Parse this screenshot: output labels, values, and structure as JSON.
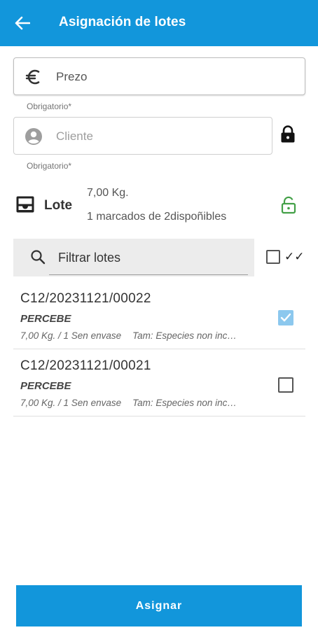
{
  "appbar": {
    "title": "Asignación de lotes",
    "back_icon": "arrow-left-icon",
    "color": "#1296db"
  },
  "price_field": {
    "placeholder": "Prezo",
    "value": "",
    "icon": "euro-icon",
    "helper": "Obrigatorio*"
  },
  "client_field": {
    "placeholder": "Cliente",
    "value": "",
    "icon": "person-icon",
    "helper": "Obrigatorio*",
    "lock_icon": "lock-closed-icon"
  },
  "lote": {
    "icon": "inbox-tray-icon",
    "label": "Lote",
    "weight": "7,00 Kg.",
    "marked": "1 marcados de 2dispoñibles",
    "lock_icon": "lock-open-icon",
    "lock_color": "#43a047"
  },
  "filter": {
    "placeholder": "Filtrar lotes",
    "icon": "search-icon",
    "double_check": "✓✓"
  },
  "lots": [
    {
      "code": "C12/20231121/00022",
      "species": "PERCEBE",
      "qty": "7,00 Kg. / 1 Sen envase",
      "tam": "Tam: Especies non inc…",
      "checked": true
    },
    {
      "code": "C12/20231121/00021",
      "species": "PERCEBE",
      "qty": "7,00 Kg. / 1 Sen envase",
      "tam": "Tam: Especies non inc…",
      "checked": false
    }
  ],
  "assign_button": {
    "label": "Asignar"
  }
}
